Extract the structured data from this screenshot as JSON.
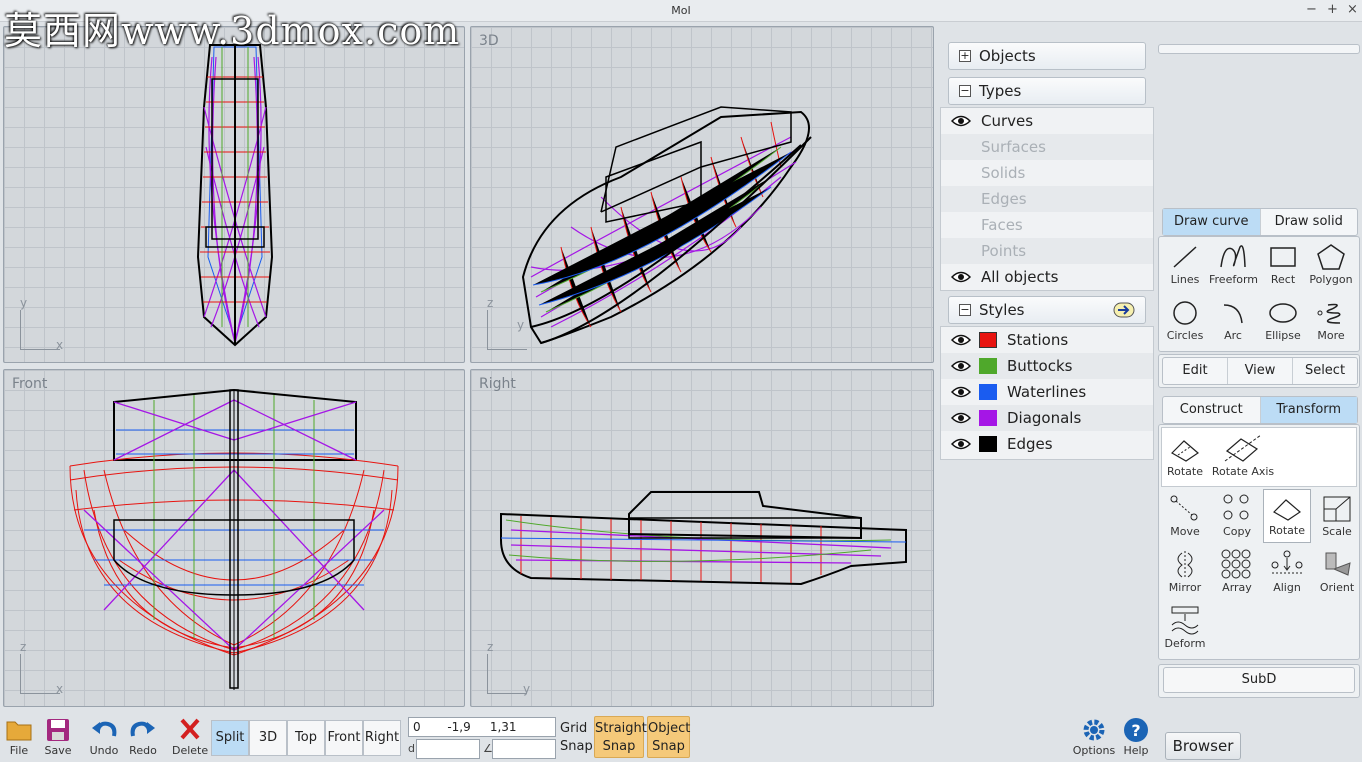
{
  "window": {
    "title": "MoI",
    "controls": [
      "−",
      "+",
      "×"
    ]
  },
  "watermark": "莫西网www.3dmox.com",
  "viewports": {
    "top": {
      "label": "",
      "axis_v": "y",
      "axis_h": "x"
    },
    "3d": {
      "label": "3D",
      "axis_v": "z",
      "axis_h": "y"
    },
    "front": {
      "label": "Front",
      "axis_v": "z",
      "axis_h": "x"
    },
    "right": {
      "label": "Right",
      "axis_v": "z",
      "axis_h": "y"
    }
  },
  "scene_panel": {
    "objects_label": "Objects",
    "types_label": "Types",
    "types": [
      {
        "label": "Curves",
        "visible": true
      },
      {
        "label": "Surfaces",
        "visible": false
      },
      {
        "label": "Solids",
        "visible": false
      },
      {
        "label": "Edges",
        "visible": false
      },
      {
        "label": "Faces",
        "visible": false
      },
      {
        "label": "Points",
        "visible": false
      },
      {
        "label": "All objects",
        "visible": true
      }
    ],
    "styles_label": "Styles",
    "styles": [
      {
        "label": "Stations",
        "color": "#e8130f"
      },
      {
        "label": "Buttocks",
        "color": "#4fa82b"
      },
      {
        "label": "Waterlines",
        "color": "#1a5cf0"
      },
      {
        "label": "Diagonals",
        "color": "#a516e6"
      },
      {
        "label": "Edges",
        "color": "#000000"
      }
    ]
  },
  "toolbar": {
    "draw_tabs": [
      "Draw curve",
      "Draw solid"
    ],
    "draw_tools": [
      "Lines",
      "Freeform",
      "Rect",
      "Polygon",
      "Circles",
      "Arc",
      "Ellipse",
      "More"
    ],
    "mode_tabs": [
      "Edit",
      "View",
      "Select"
    ],
    "transform_tabs": [
      "Construct",
      "Transform"
    ],
    "rotate_tools": [
      "Rotate",
      "Rotate Axis"
    ],
    "transform_tools": [
      "Move",
      "Copy",
      "Rotate",
      "Scale",
      "Mirror",
      "Array",
      "Align",
      "Orient",
      "Deform"
    ],
    "subd_label": "SubD"
  },
  "bottom": {
    "file": "File",
    "save": "Save",
    "undo": "Undo",
    "redo": "Redo",
    "delete": "Delete",
    "views": [
      "Split",
      "3D",
      "Top",
      "Front",
      "Right"
    ],
    "coord_value": "0       -1,9     1,31",
    "d_label": "d",
    "angle_label": "∠",
    "grid_snap": [
      "Grid",
      "Snap"
    ],
    "straight_snap": [
      "Straight",
      "Snap"
    ],
    "object_snap": [
      "Object",
      "Snap"
    ],
    "options": "Options",
    "help": "Help",
    "browser": "Browser"
  }
}
